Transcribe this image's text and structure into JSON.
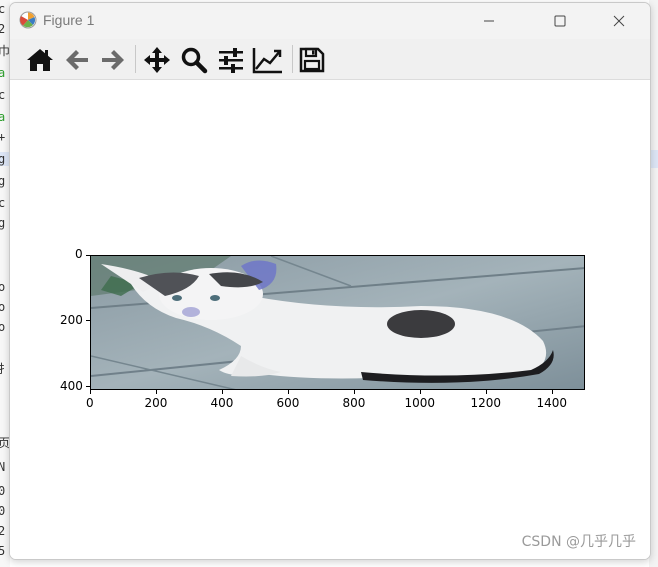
{
  "window": {
    "title": "Figure 1",
    "icons": [
      "matplotlib-app-icon",
      "minimize-icon",
      "maximize-icon",
      "close-icon"
    ]
  },
  "toolbar": {
    "buttons": [
      {
        "name": "home-icon",
        "action": "Home"
      },
      {
        "name": "back-arrow-icon",
        "action": "Back"
      },
      {
        "name": "forward-arrow-icon",
        "action": "Forward"
      },
      {
        "name": "pan-icon",
        "action": "Pan"
      },
      {
        "name": "zoom-icon",
        "action": "Zoom"
      },
      {
        "name": "subplots-icon",
        "action": "Configure subplots"
      },
      {
        "name": "edit-axes-icon",
        "action": "Edit axis"
      },
      {
        "name": "save-icon",
        "action": "Save"
      }
    ]
  },
  "plot": {
    "image_subject": "white kitten with gray patches on pavement",
    "xticks": [
      "0",
      "200",
      "400",
      "600",
      "800",
      "1000",
      "1200",
      "1400"
    ],
    "yticks": [
      "0",
      "200",
      "400"
    ],
    "x_range": [
      0,
      1500
    ],
    "y_range": [
      410,
      0
    ]
  },
  "watermark": "CSDN @几乎几乎",
  "colors": {
    "titlebar": "#f3f3f3",
    "toolbar": "#f0f0f0",
    "pavement": "#8ea0aa",
    "kitten": "#f2f2f2"
  }
}
